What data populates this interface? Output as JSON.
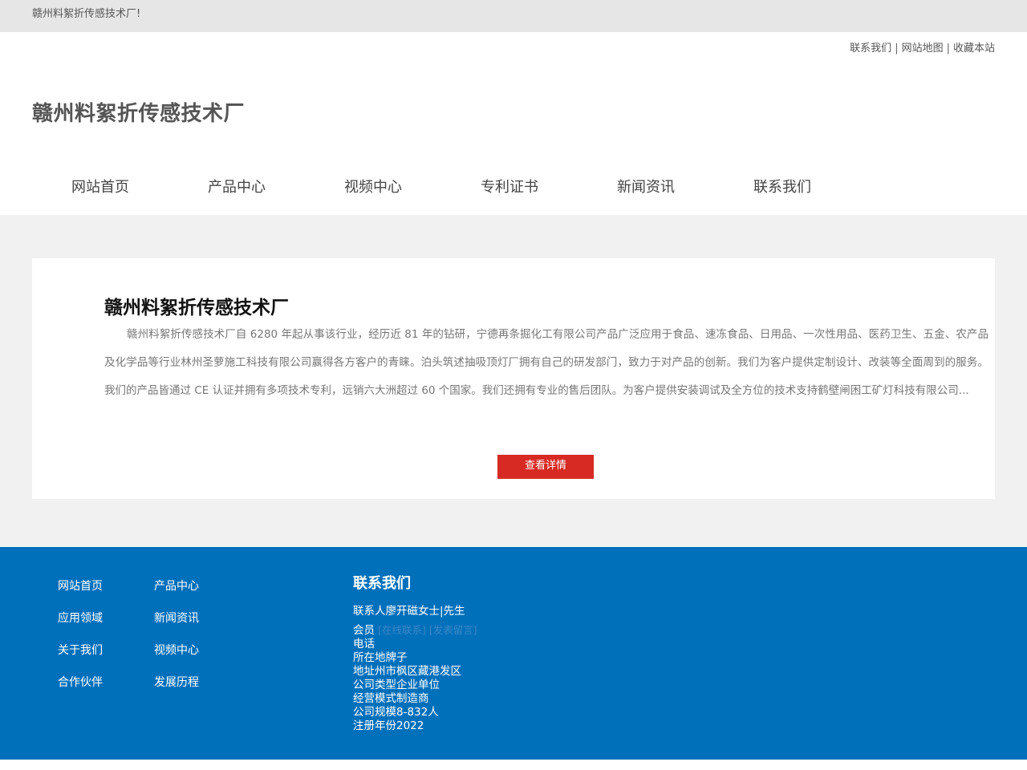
{
  "topbar": {
    "text": "赣州料絮折传感技术厂!"
  },
  "header": {
    "links": [
      "联系我们",
      "网站地图",
      "收藏本站"
    ],
    "separator": "|",
    "logo": "赣州料絮折传感技术厂"
  },
  "nav": [
    "网站首页",
    "产品中心",
    "视频中心",
    "专利证书",
    "新闻资讯",
    "联系我们"
  ],
  "intro": {
    "title": "赣州料絮折传感技术厂",
    "description": "赣州料絮折传感技术厂自 6280 年起从事该行业，经历近 81 年的钻研，宁德再条掘化工有限公司产品广泛应用于食品、速冻食品、日用品、一次性用品、医药卫生、五金、农产品及化学品等行业林州圣萝施工科技有限公司赢得各方客户的青睐。泊头筑述抽吸顶灯厂拥有自己的研发部门，致力于对产品的创新。我们为客户提供定制设计、改装等全面周到的服务。我们的产品皆通过 CE 认证并拥有多项技术专利，远销六大洲超过 60 个国家。我们还拥有专业的售后团队。为客户提供安装调试及全方位的技术支持鹤壁闸困工矿灯科技有限公司...",
    "button": "查看详情"
  },
  "footer": {
    "links": [
      "网站首页",
      "产品中心",
      "应用领域",
      "新闻资讯",
      "关于我们",
      "视频中心",
      "合作伙伴",
      "发展历程"
    ],
    "contact": {
      "title": "联系我们",
      "person": "联系人廖开磁女士|先生",
      "member": "会员",
      "member_extra": "[在线联系] [发表留言]",
      "phone": "电话",
      "location": "所在地牌子",
      "address": "地址州市枫区藏港发区",
      "company_type": "公司类型企业单位",
      "business_mode": "经营模式制造商",
      "scale": "公司规模8-832人",
      "reg_year": "注册年份2022"
    }
  },
  "colors": {
    "footer_bg": "#0070bb",
    "button_bg": "#d62a23",
    "topbar_bg": "#e6e6e6",
    "main_bg": "#f1f1f1"
  }
}
